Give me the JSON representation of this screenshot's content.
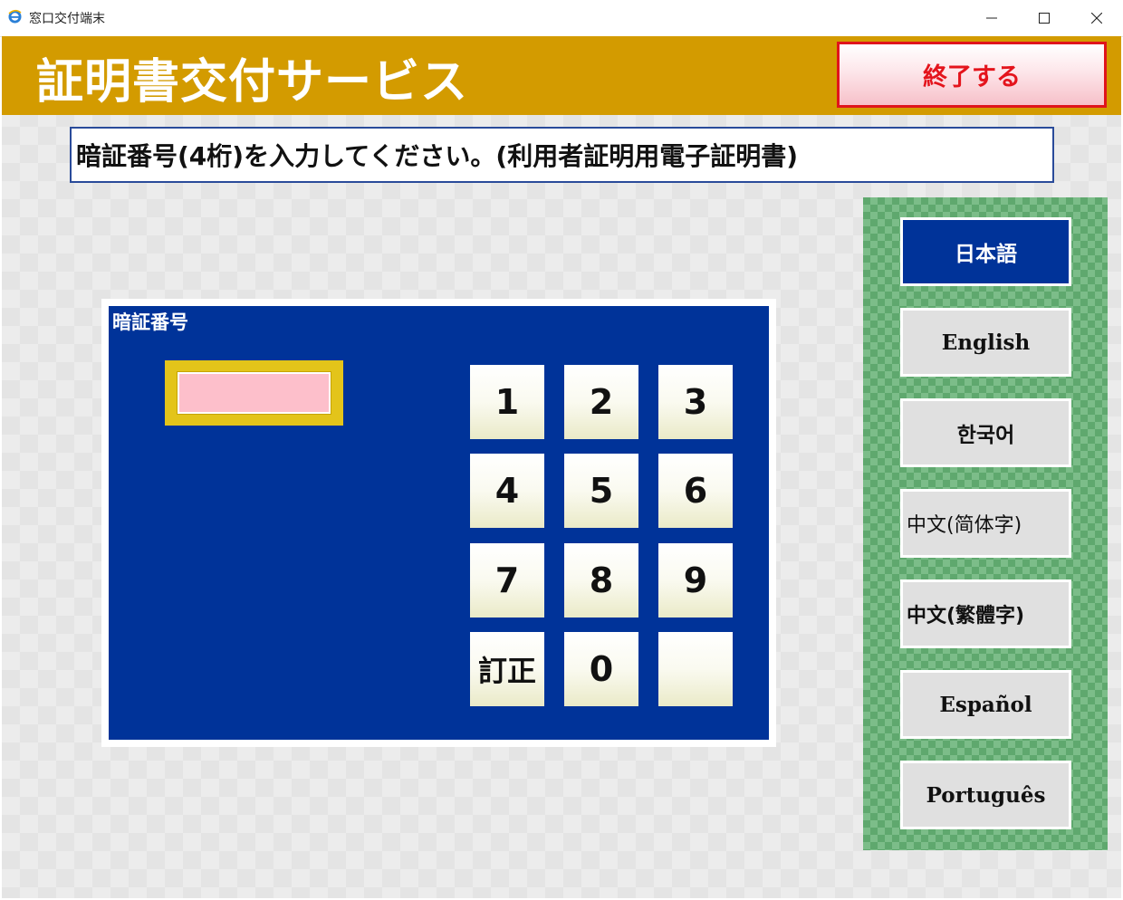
{
  "window": {
    "title": "窓口交付端末",
    "icons": [
      "ie-app-icon",
      "minimize-icon",
      "maximize-icon",
      "close-icon"
    ]
  },
  "header": {
    "title": "証明書交付サービス",
    "exit_label": "終了する"
  },
  "instruction": "暗証番号(4桁)を入力してください。(利用者証明用電子証明書)",
  "pin": {
    "label": "暗証番号",
    "value": ""
  },
  "keypad": {
    "keys": [
      "1",
      "2",
      "3",
      "4",
      "5",
      "6",
      "7",
      "8",
      "9",
      "訂正",
      "0",
      ""
    ]
  },
  "languages": [
    {
      "label": "日本語",
      "selected": true
    },
    {
      "label": "English",
      "selected": false
    },
    {
      "label": "한국어",
      "selected": false
    },
    {
      "label": "中文(简体字)",
      "selected": false
    },
    {
      "label": "中文(繁體字)",
      "selected": false
    },
    {
      "label": "Español",
      "selected": false
    },
    {
      "label": "Português",
      "selected": false
    }
  ],
  "colors": {
    "header_bg": "#d39b00",
    "panel_blue": "#003399",
    "exit_red": "#e4141c",
    "pin_field": "#fdbfcb",
    "pin_frame": "#e3c41a",
    "language_panel": "#5fa86e"
  }
}
